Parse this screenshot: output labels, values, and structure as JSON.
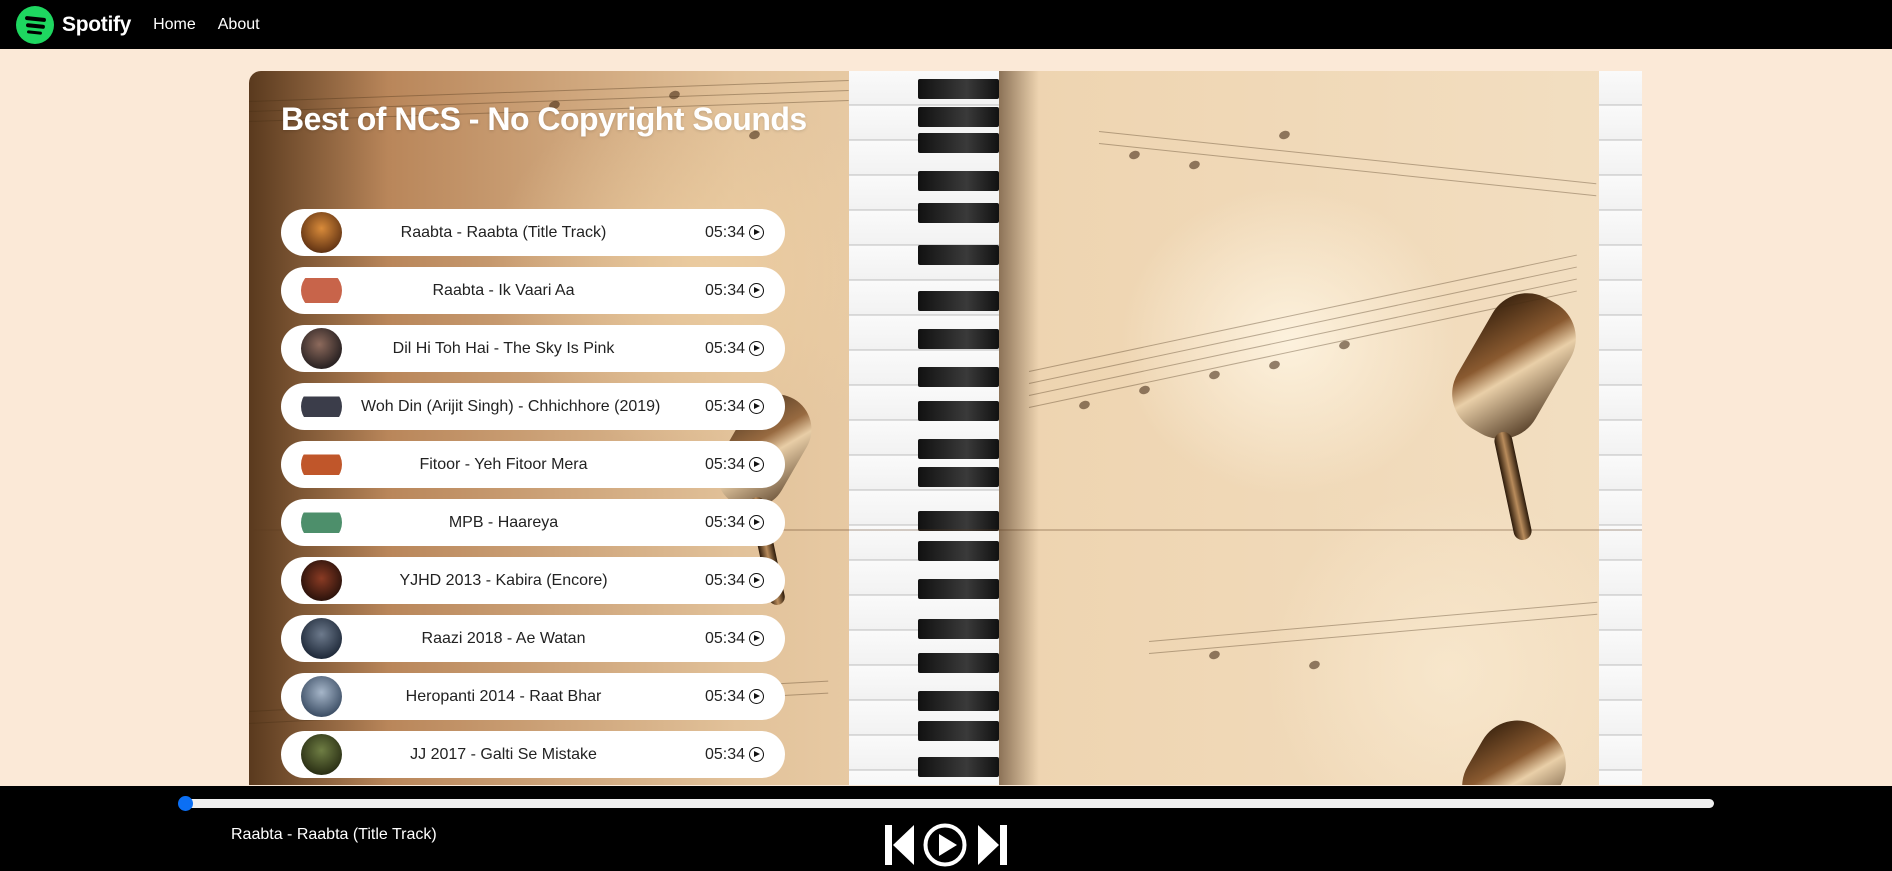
{
  "navbar": {
    "brand": "Spotify",
    "links": [
      "Home",
      "About"
    ]
  },
  "playlist": {
    "title": "Best of NCS - No Copyright Sounds",
    "songs": [
      {
        "name": "Raabta - Raabta (Title Track)",
        "duration": "05:34"
      },
      {
        "name": "Raabta - Ik Vaari Aa",
        "duration": "05:34"
      },
      {
        "name": "Dil Hi Toh Hai - The Sky Is Pink",
        "duration": "05:34"
      },
      {
        "name": "Woh Din (Arijit Singh) - Chhichhore (2019)",
        "duration": "05:34"
      },
      {
        "name": "Fitoor - Yeh Fitoor Mera",
        "duration": "05:34"
      },
      {
        "name": "MPB - Haareya",
        "duration": "05:34"
      },
      {
        "name": "YJHD 2013 - Kabira (Encore)",
        "duration": "05:34"
      },
      {
        "name": "Raazi 2018 - Ae Watan",
        "duration": "05:34"
      },
      {
        "name": "Heropanti 2014 - Raat Bhar",
        "duration": "05:34"
      },
      {
        "name": "JJ 2017 - Galti Se Mistake",
        "duration": "05:34"
      }
    ]
  },
  "player": {
    "now_playing": "Raabta - Raabta (Title Track)",
    "progress": 0
  },
  "colors": {
    "accent": "#1ed760",
    "progress_thumb": "#0b6ff4",
    "background": "#fbe9d7"
  }
}
